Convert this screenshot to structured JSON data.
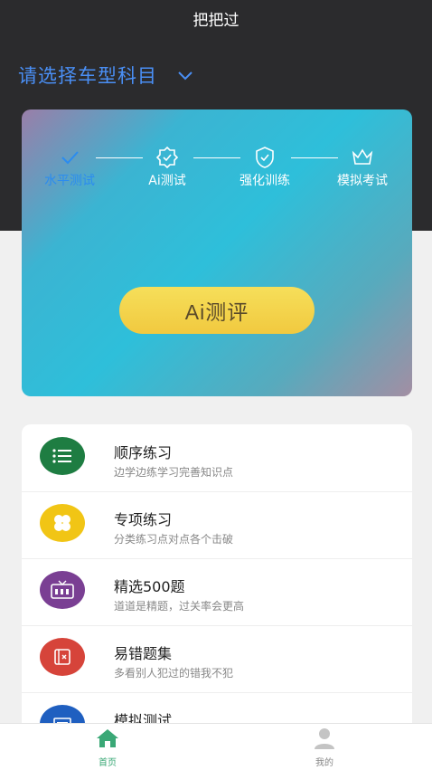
{
  "app": {
    "title": "把把过"
  },
  "selector": {
    "label": "请选择车型科目"
  },
  "steps": [
    {
      "label": "水平测试",
      "icon": "check-icon",
      "active": true
    },
    {
      "label": "Ai测试",
      "icon": "ai-badge-icon",
      "active": false
    },
    {
      "label": "强化训练",
      "icon": "shield-check-icon",
      "active": false
    },
    {
      "label": "模拟考试",
      "icon": "crown-icon",
      "active": false
    }
  ],
  "cta": {
    "label": "Ai测评"
  },
  "items": [
    {
      "title": "顺序练习",
      "sub": "边学边练学习完善知识点",
      "icon": "list-icon",
      "color": "#1e7d42"
    },
    {
      "title": "专项练习",
      "sub": "分类练习点对点各个击破",
      "icon": "clover-icon",
      "color": "#f1c515"
    },
    {
      "title": "精选500题",
      "sub": "道道是精题，过关率会更高",
      "icon": "500-icon",
      "color": "#7a3f93"
    },
    {
      "title": "易错题集",
      "sub": "多看别人犯过的错我不犯",
      "icon": "error-book-icon",
      "color": "#d6443a"
    },
    {
      "title": "模拟测试",
      "sub": "",
      "icon": "mock-test-icon",
      "color": "#1f5fc0"
    }
  ],
  "tabs": [
    {
      "label": "首页",
      "icon": "home-icon",
      "color": "#3aa876",
      "active": true
    },
    {
      "label": "我的",
      "icon": "user-icon",
      "color": "#888888",
      "active": false
    }
  ]
}
